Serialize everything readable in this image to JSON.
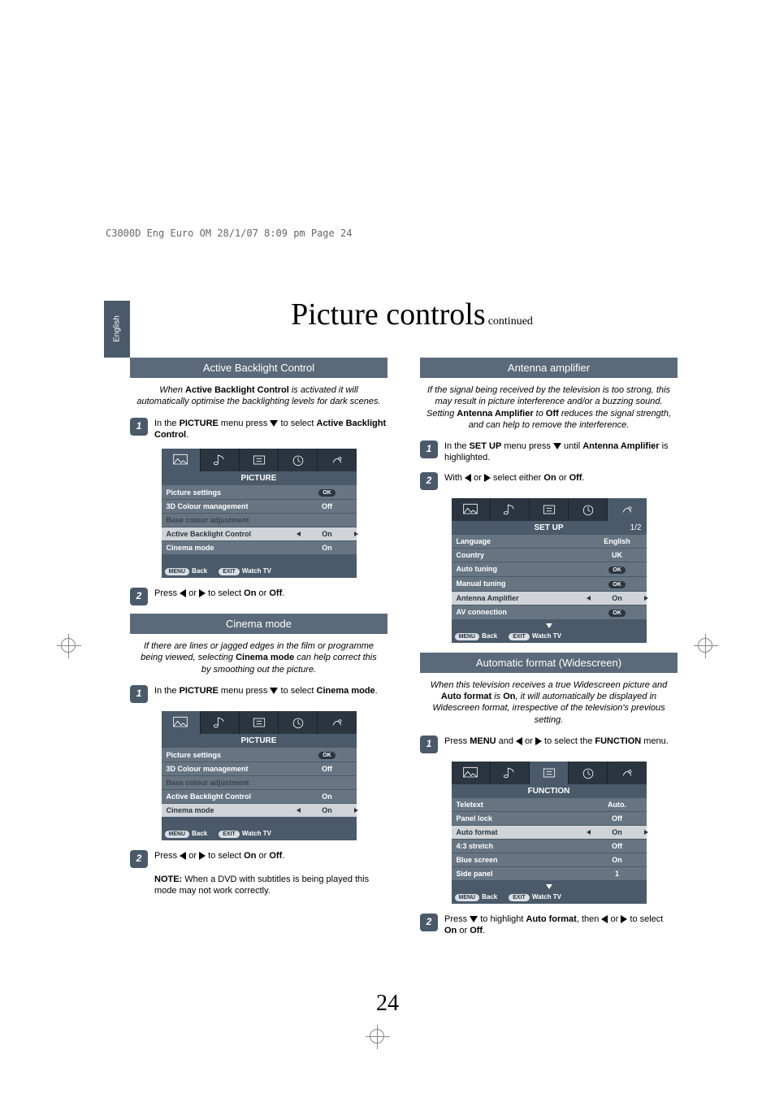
{
  "meta": {
    "header": "C3000D Eng Euro OM  28/1/07  8:09 pm  Page 24"
  },
  "lang": "English",
  "title": "Picture controls",
  "title_sub": "continued",
  "page_number": "24",
  "backlight": {
    "heading": "Active Backlight Control",
    "intro_pre": "When ",
    "intro_bold": "Active Backlight Control",
    "intro_post": " is activated it will automatically optimise the backlighting levels for dark scenes.",
    "step1_a": "In the ",
    "step1_b": "PICTURE",
    "step1_c": " menu press ",
    "step1_d": " to select ",
    "step1_e": "Active Backlight Control",
    "step1_f": ".",
    "step2_a": "Press ",
    "step2_b": " or ",
    "step2_c": " to select ",
    "step2_d": "On",
    "step2_e": " or ",
    "step2_f": "Off",
    "step2_g": "."
  },
  "osd_picture": {
    "title": "PICTURE",
    "rows": {
      "picture_settings": "Picture settings",
      "cm3d": "3D Colour management",
      "cm3d_val": "Off",
      "base": "Base colour adjustment",
      "abc": "Active Backlight Control",
      "abc_val": "On",
      "cinema": "Cinema mode",
      "cinema_val": "On"
    },
    "footer": {
      "menu": "MENU",
      "back": "Back",
      "exit": "EXIT",
      "watch": "Watch TV"
    }
  },
  "cinema": {
    "heading": "Cinema mode",
    "intro_a": "If there are lines or jagged edges in the film or programme being viewed, selecting ",
    "intro_b": "Cinema mode",
    "intro_c": " can help correct this by smoothing out the picture.",
    "step1_a": "In the ",
    "step1_b": "PICTURE",
    "step1_c": " menu press ",
    "step1_d": " to select ",
    "step1_e": "Cinema mode",
    "step1_f": ".",
    "step2_a": "Press ",
    "step2_b": " or ",
    "step2_c": " to select ",
    "step2_d": "On",
    "step2_e": " or ",
    "step2_f": "Off",
    "step2_g": ".",
    "note_label": "NOTE:",
    "note": " When a DVD with subtitles is being played this mode may not work correctly."
  },
  "antenna": {
    "heading": "Antenna amplifier",
    "intro_a": "If the signal being received by the television is too strong, this may result in picture interference and/or a buzzing sound. Setting ",
    "intro_b": "Antenna Amplifier",
    "intro_c": " to ",
    "intro_d": "Off",
    "intro_e": " reduces the signal strength, and can help to remove the interference.",
    "step1_a": "In the ",
    "step1_b": "SET UP",
    "step1_c": " menu press ",
    "step1_d": " until ",
    "step1_e": "Antenna Amplifier",
    "step1_f": " is highlighted.",
    "step2_a": "With ",
    "step2_b": " or ",
    "step2_c": " select either ",
    "step2_d": "On",
    "step2_e": " or ",
    "step2_f": "Off",
    "step2_g": "."
  },
  "osd_setup": {
    "title": "SET UP",
    "page": "1/2",
    "rows": {
      "language": "Language",
      "language_val": "English",
      "country": "Country",
      "country_val": "UK",
      "autotune": "Auto tuning",
      "mantune": "Manual tuning",
      "antamp": "Antenna Amplifier",
      "antamp_val": "On",
      "avconn": "AV connection"
    }
  },
  "autoformat": {
    "heading": "Automatic format (Widescreen)",
    "intro_a": "When this television receives a true Widescreen picture and ",
    "intro_b": "Auto format",
    "intro_c": " is ",
    "intro_d": "On",
    "intro_e": ", it will automatically be displayed in Widescreen format, irrespective of the television's previous setting.",
    "step1_a": "Press ",
    "step1_b": "MENU",
    "step1_c": " and ",
    "step1_d": " or ",
    "step1_e": " to select the ",
    "step1_f": "FUNCTION",
    "step1_g": " menu.",
    "step2_a": "Press ",
    "step2_b": " to highlight ",
    "step2_c": "Auto format",
    "step2_d": ", then ",
    "step2_e": " or ",
    "step2_f": " to select ",
    "step2_g": "On",
    "step2_h": " or ",
    "step2_i": "Off",
    "step2_j": "."
  },
  "osd_function": {
    "title": "FUNCTION",
    "rows": {
      "teletext": "Teletext",
      "teletext_val": "Auto.",
      "panel": "Panel lock",
      "panel_val": "Off",
      "autoformat": "Auto format",
      "autoformat_val": "On",
      "stretch": "4:3 stretch",
      "stretch_val": "Off",
      "blue": "Blue screen",
      "blue_val": "On",
      "side": "Side panel",
      "side_val": "1"
    }
  },
  "ok": "OK"
}
